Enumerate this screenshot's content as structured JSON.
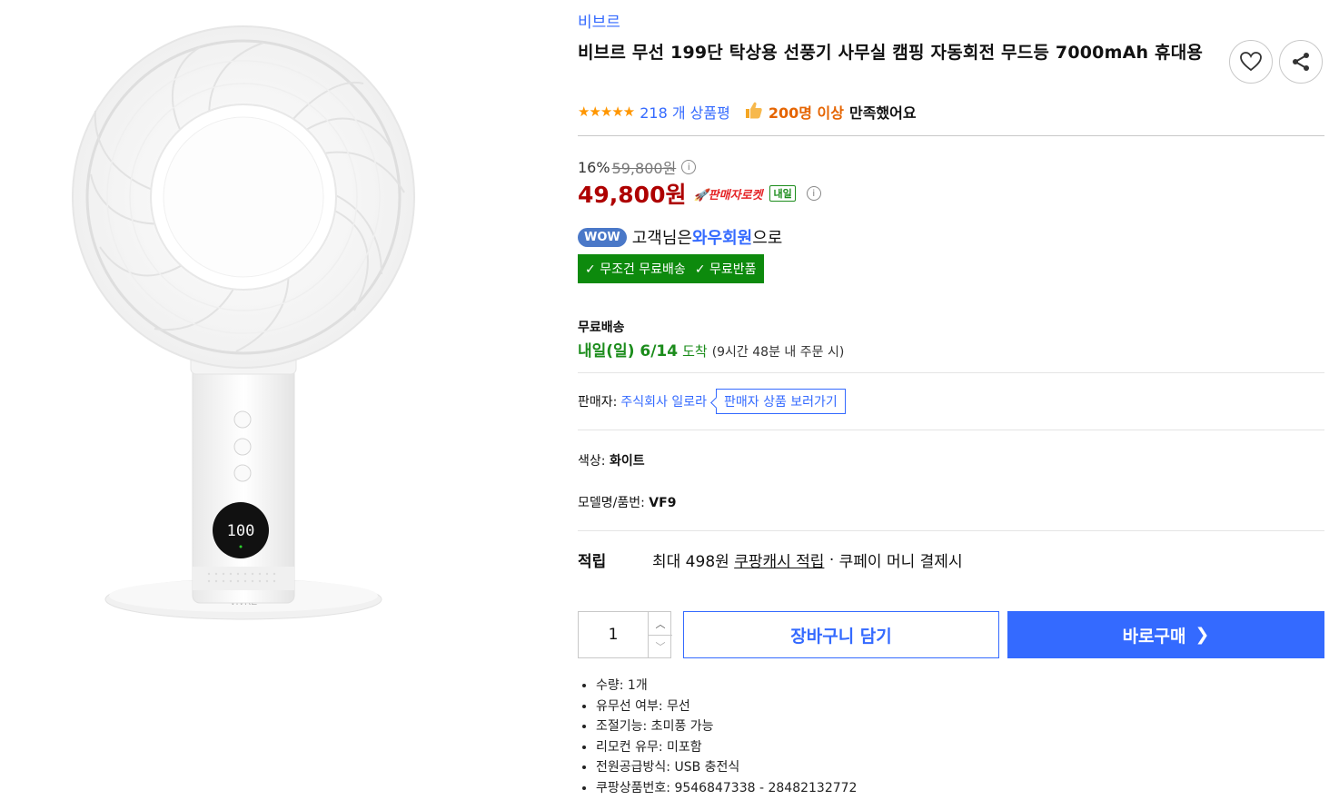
{
  "brand": "비브르",
  "title": "비브르 무선 199단 탁상용 선풍기 사무실 캠핑 자동회전 무드등 7000mAh 휴대용",
  "rating": {
    "stars": 5,
    "review_count": "218 개 상품평",
    "satisfaction_count": "200명 이상",
    "satisfaction_suffix": "만족했어요"
  },
  "pricing": {
    "discount_rate": "16%",
    "original_price": "59,800원",
    "sale_price": "49,800원",
    "rocket_label": "판매자로켓",
    "tomorrow_badge": "내일"
  },
  "wow": {
    "badge": "WOW",
    "prefix": "고객님은",
    "member": "와우회원",
    "suffix": "으로",
    "benefit_1": "무조건 무료배송",
    "benefit_2": "무료반품"
  },
  "shipping": {
    "label": "무료배송",
    "date": "내일(일) 6/14",
    "arrive": "도착",
    "cutoff": "(9시간 48분 내 주문 시)"
  },
  "seller": {
    "label": "판매자:",
    "name": "주식회사 일로라",
    "link": "판매자 상품 보러가기"
  },
  "options": {
    "color_label": "색상:",
    "color_value": "화이트",
    "model_label": "모델명/품번:",
    "model_value": "VF9"
  },
  "reward": {
    "label": "적립",
    "max": "최대 498원",
    "cash": "쿠팡캐시 적립",
    "sep": "·",
    "pay": "쿠페이 머니 결제시"
  },
  "purchase": {
    "quantity": "1",
    "cart_label": "장바구니 담기",
    "buy_label": "바로구매"
  },
  "specs": [
    "수량: 1개",
    "유무선 여부: 무선",
    "조절기능: 초미풍 가능",
    "리모컨 유무: 미포함",
    "전원공급방식: USB 충전식",
    "쿠팡상품번호: 9546847338 - 28482132772"
  ],
  "fan_display": "100",
  "fan_logo": "VIVRE",
  "colors": {
    "accent": "#346aff",
    "price_red": "#ae0000",
    "free_green": "#0d8a0d",
    "orange": "#e56400"
  }
}
